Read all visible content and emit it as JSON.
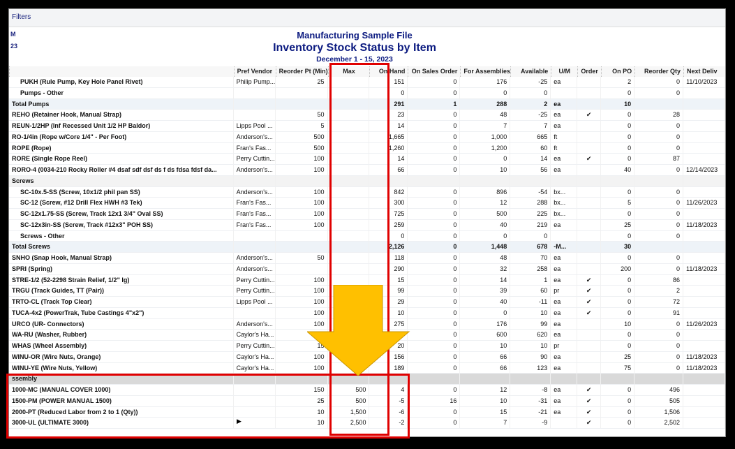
{
  "filters_label": "Filters",
  "side": {
    "a": "M",
    "b": "23"
  },
  "report": {
    "company": "Manufacturing Sample File",
    "title": "Inventory Stock Status by Item",
    "date_range": "December 1 - 15, 2023"
  },
  "columns": [
    "",
    "Pref Vendor",
    "Reorder Pt (Min)",
    "Max",
    "On Hand",
    "On Sales Order",
    "For Assemblies",
    "Available",
    "U/M",
    "Order",
    "On PO",
    "Reorder Qty",
    "Next Deliv"
  ],
  "rows": [
    {
      "type": "sub",
      "cells": [
        "PUKH (Rule Pump, Key Hole Panel Rivet)",
        "Philip Pump...",
        "25",
        "",
        "151",
        "0",
        "176",
        "-25",
        "ea",
        "",
        "2",
        "0",
        "11/10/2023"
      ]
    },
    {
      "type": "sub",
      "ul": true,
      "cells": [
        "Pumps - Other",
        "",
        "",
        "",
        "0",
        "0",
        "0",
        "0",
        "",
        "",
        "0",
        "0",
        ""
      ]
    },
    {
      "type": "total",
      "cells": [
        "Total Pumps",
        "",
        "",
        "",
        "291",
        "1",
        "288",
        "2",
        "ea",
        "",
        "10",
        "",
        ""
      ]
    },
    {
      "type": "item",
      "cells": [
        "REHO (Retainer Hook, Manual Strap)",
        "",
        "50",
        "",
        "23",
        "0",
        "48",
        "-25",
        "ea",
        "✔",
        "0",
        "28",
        ""
      ]
    },
    {
      "type": "item",
      "cells": [
        "REUN-1/2HP (Inf Recessed Unit 1/2 HP Baldor)",
        "Lipps Pool ...",
        "5",
        "",
        "14",
        "0",
        "7",
        "7",
        "ea",
        "",
        "0",
        "0",
        ""
      ]
    },
    {
      "type": "item",
      "cells": [
        "RO-1/4in (Rope w/Core 1/4\" - Per Foot)",
        "Anderson's...",
        "500",
        "",
        "1,665",
        "0",
        "1,000",
        "665",
        "ft",
        "",
        "0",
        "0",
        ""
      ]
    },
    {
      "type": "item",
      "cells": [
        "ROPE (Rope)",
        "Fran's Fas...",
        "500",
        "",
        "1,260",
        "0",
        "1,200",
        "60",
        "ft",
        "",
        "0",
        "0",
        ""
      ]
    },
    {
      "type": "item",
      "cells": [
        "RORE (Single Rope Reel)",
        "Perry Cuttin...",
        "100",
        "",
        "14",
        "0",
        "0",
        "14",
        "ea",
        "✔",
        "0",
        "87",
        ""
      ]
    },
    {
      "type": "item",
      "cells": [
        "RORO-4 (0034-210  Rocky Roller #4   dsaf  sdf  dsf  ds  f  ds  fdsa  fdsf  da...",
        "Anderson's...",
        "100",
        "",
        "66",
        "0",
        "10",
        "56",
        "ea",
        "",
        "40",
        "0",
        "12/14/2023"
      ]
    },
    {
      "type": "group",
      "cells": [
        "Screws",
        "",
        "",
        "",
        "",
        "",
        "",
        "",
        "",
        "",
        "",
        "",
        ""
      ]
    },
    {
      "type": "sub",
      "cells": [
        "SC-10x.5-SS (Screw, 10x1/2 phil pan SS)",
        "Anderson's...",
        "100",
        "",
        "842",
        "0",
        "896",
        "-54",
        "bx...",
        "",
        "0",
        "0",
        ""
      ]
    },
    {
      "type": "sub",
      "cells": [
        "SC-12 (Screw, #12 Drill Flex HWH #3 Tek)",
        "Fran's Fas...",
        "100",
        "",
        "300",
        "0",
        "12",
        "288",
        "bx...",
        "",
        "5",
        "0",
        "11/26/2023"
      ]
    },
    {
      "type": "sub",
      "cells": [
        "SC-12x1.75-SS (Screw, Track 12x1 3/4\" Oval SS)",
        "Fran's Fas...",
        "100",
        "",
        "725",
        "0",
        "500",
        "225",
        "bx...",
        "",
        "0",
        "0",
        ""
      ]
    },
    {
      "type": "sub",
      "cells": [
        "SC-12x3in-SS (Screw, Track #12x3\" POH SS)",
        "Fran's Fas...",
        "100",
        "",
        "259",
        "0",
        "40",
        "219",
        "ea",
        "",
        "25",
        "0",
        "11/18/2023"
      ]
    },
    {
      "type": "sub",
      "ul": true,
      "cells": [
        "Screws - Other",
        "",
        "",
        "",
        "0",
        "0",
        "0",
        "0",
        "",
        "",
        "0",
        "0",
        ""
      ]
    },
    {
      "type": "total",
      "cells": [
        "Total Screws",
        "",
        "",
        "",
        "2,126",
        "0",
        "1,448",
        "678",
        "-M...",
        "",
        "30",
        "",
        ""
      ]
    },
    {
      "type": "item",
      "cells": [
        "SNHO (Snap Hook, Manual Strap)",
        "Anderson's...",
        "50",
        "",
        "118",
        "0",
        "48",
        "70",
        "ea",
        "",
        "0",
        "0",
        ""
      ]
    },
    {
      "type": "item",
      "cells": [
        "SPRI (Spring)",
        "Anderson's...",
        "",
        "",
        "290",
        "0",
        "32",
        "258",
        "ea",
        "",
        "200",
        "0",
        "11/18/2023"
      ]
    },
    {
      "type": "item",
      "cells": [
        "STRE-1/2 (52-2298  Strain Relief, 1/2\" lg)",
        "Perry Cuttin...",
        "100",
        "",
        "15",
        "0",
        "14",
        "1",
        "ea",
        "✔",
        "0",
        "86",
        ""
      ]
    },
    {
      "type": "item",
      "cells": [
        "TRGU (Track Guides, TT (Pair))",
        "Perry Cuttin...",
        "100",
        "",
        "99",
        "0",
        "39",
        "60",
        "pr",
        "✔",
        "0",
        "2",
        ""
      ]
    },
    {
      "type": "item",
      "cells": [
        "TRTO-CL (Track Top Clear)",
        "Lipps Pool ...",
        "100",
        "",
        "29",
        "0",
        "40",
        "-11",
        "ea",
        "✔",
        "0",
        "72",
        ""
      ]
    },
    {
      "type": "item",
      "cells": [
        "TUCA-4x2 (PowerTrak, Tube Castings 4\"x2\")",
        "",
        "100",
        "",
        "10",
        "0",
        "0",
        "10",
        "ea",
        "✔",
        "0",
        "91",
        ""
      ]
    },
    {
      "type": "item",
      "cells": [
        "URCO (UR- Connectors)",
        "Anderson's...",
        "100",
        "",
        "275",
        "0",
        "176",
        "99",
        "ea",
        "",
        "10",
        "0",
        "11/26/2023"
      ]
    },
    {
      "type": "item",
      "cells": [
        "WA-RU (Washer, Rubber)",
        "Caylor's Ha...",
        "",
        "",
        "",
        "0",
        "600",
        "620",
        "ea",
        "",
        "0",
        "0",
        ""
      ]
    },
    {
      "type": "item",
      "cells": [
        "WHAS (Wheel Assembly)",
        "Perry Cuttin...",
        "15",
        "",
        "20",
        "0",
        "10",
        "10",
        "pr",
        "",
        "0",
        "0",
        ""
      ]
    },
    {
      "type": "item",
      "cells": [
        "WINU-OR (Wire Nuts, Orange)",
        "Caylor's Ha...",
        "100",
        "",
        "156",
        "0",
        "66",
        "90",
        "ea",
        "",
        "25",
        "0",
        "11/18/2023"
      ]
    },
    {
      "type": "item",
      "cells": [
        "WINU-YE (Wire Nuts, Yellow)",
        "Caylor's Ha...",
        "100",
        "",
        "189",
        "0",
        "66",
        "123",
        "ea",
        "",
        "75",
        "0",
        "11/18/2023"
      ]
    },
    {
      "type": "group asm",
      "cells": [
        "ssembly",
        "",
        "",
        "",
        "",
        "",
        "",
        "",
        "",
        "",
        "",
        "",
        ""
      ]
    },
    {
      "type": "item",
      "cells": [
        "1000-MC (MANUAL COVER 1000)",
        "",
        "150",
        "500",
        "4",
        "0",
        "12",
        "-8",
        "ea",
        "✔",
        "0",
        "496",
        ""
      ]
    },
    {
      "type": "item",
      "cells": [
        "1500-PM (POWER MANUAL 1500)",
        "",
        "25",
        "500",
        "-5",
        "16",
        "10",
        "-31",
        "ea",
        "✔",
        "0",
        "505",
        ""
      ]
    },
    {
      "type": "item",
      "cells": [
        "2000-PT (Reduced Labor from 2 to 1 (Qty))",
        "",
        "10",
        "1,500",
        "-6",
        "0",
        "15",
        "-21",
        "ea",
        "✔",
        "0",
        "1,506",
        ""
      ]
    },
    {
      "type": "item",
      "cells": [
        "3000-UL (ULTIMATE 3000)",
        "",
        "10",
        "2,500",
        "-2",
        "0",
        "7",
        "-9",
        "",
        "✔",
        "0",
        "2,502",
        ""
      ]
    }
  ],
  "colors": {
    "highlight": "#e00000",
    "arrow": "#ffc000",
    "title": "#0b1a80"
  },
  "icons": {
    "arrow": "down-arrow-icon",
    "pointer": "row-pointer-icon",
    "check": "checkmark-icon"
  }
}
